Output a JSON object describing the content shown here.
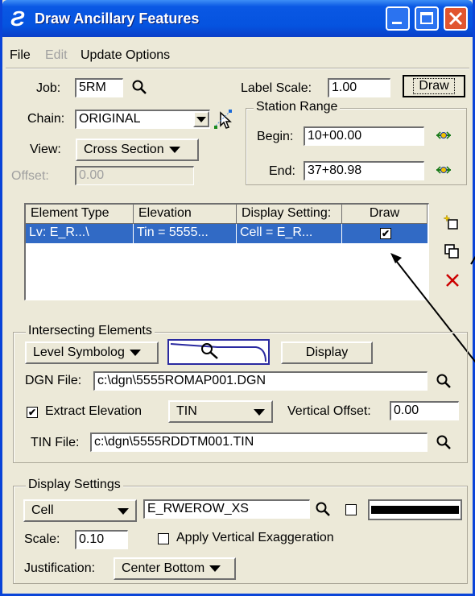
{
  "window": {
    "title": "Draw Ancillary Features",
    "title_icon_glyph": "Ƨ"
  },
  "menu": [
    {
      "label": "File",
      "enabled": true
    },
    {
      "label": "Edit",
      "enabled": false
    },
    {
      "label": "Update Options",
      "enabled": true
    }
  ],
  "job": {
    "label": "Job:",
    "value": "5RM"
  },
  "chain": {
    "label": "Chain:",
    "value": "ORIGINAL"
  },
  "view": {
    "label": "View:",
    "value": "Cross Section"
  },
  "offset": {
    "label": "Offset:",
    "value": "0.00"
  },
  "label_scale": {
    "label": "Label Scale:",
    "value": "1.00"
  },
  "draw_button": "Draw",
  "station_range": {
    "title": "Station Range",
    "begin_label": "Begin:",
    "begin_value": "10+00.00",
    "end_label": "End:",
    "end_value": "37+80.98"
  },
  "table": {
    "headers": [
      "Element Type",
      "Elevation",
      "Display Setting:",
      "Draw"
    ],
    "rows": [
      {
        "element_type": "Lv: E_R...\\",
        "elevation": "Tin = 5555...",
        "display_setting": "Cell = E_R...",
        "draw": true
      }
    ]
  },
  "intersecting": {
    "title": "Intersecting Elements",
    "mode": "Level Symbolog",
    "display_button": "Display",
    "dgn_label": "DGN File:",
    "dgn_value": "c:\\dgn\\5555ROMAP001.DGN",
    "extract_label": "Extract Elevation",
    "extract_checked": true,
    "extract_type": "TIN",
    "vertical_offset_label": "Vertical Offset:",
    "vertical_offset_value": "0.00",
    "tin_label": "TIN File:",
    "tin_value": "c:\\dgn\\5555RDDTM001.TIN"
  },
  "display_settings": {
    "title": "Display Settings",
    "type": "Cell",
    "cell_name": "E_RWEROW_XS",
    "scale_label": "Scale:",
    "scale_value": "0.10",
    "apply_vert_label": "Apply Vertical Exaggeration",
    "apply_vert_checked": false,
    "justification_label": "Justification:",
    "justification_value": "Center Bottom"
  },
  "colors": {
    "title_bar": "#0553df",
    "selection": "#316ac5",
    "dialog_bg": "#ece9d8",
    "close_button": "#e1552f",
    "delete_icon": "#cc0000"
  }
}
